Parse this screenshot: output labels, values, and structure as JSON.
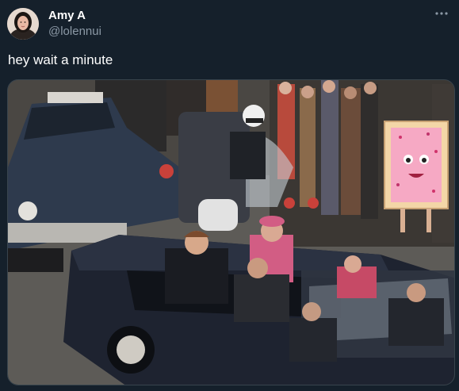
{
  "author": {
    "display_name": "Amy A",
    "handle": "@lolennui",
    "avatar_icon": "profile-photo"
  },
  "tweet": {
    "text": "hey wait a minute"
  },
  "menu": {
    "icon": "more-options-icon"
  },
  "media": {
    "kind": "photo",
    "description_icon": "motorcade-photo"
  },
  "colors": {
    "background": "#15202b",
    "primary_text": "#ffffff",
    "secondary_text": "#8b98a5",
    "border": "#38444d"
  }
}
